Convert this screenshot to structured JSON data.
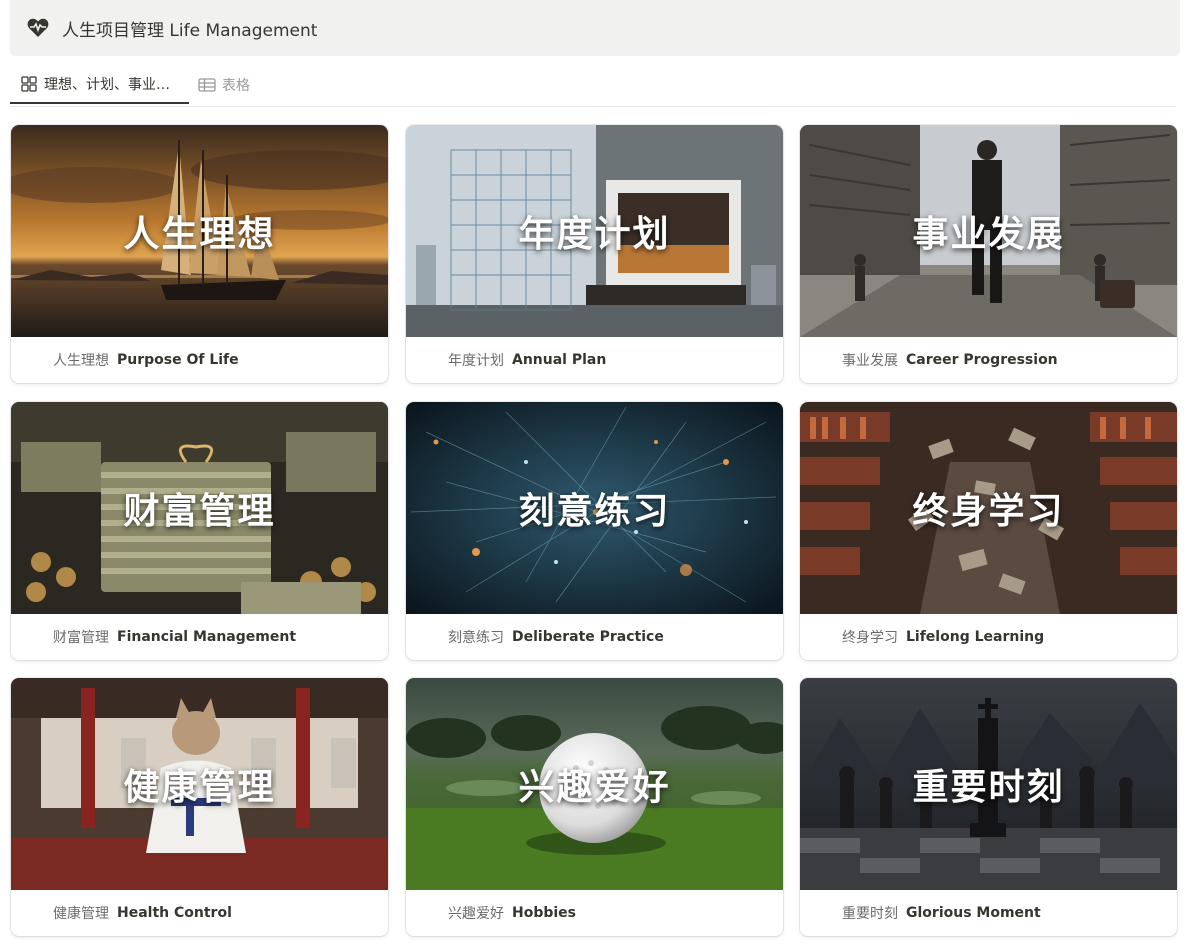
{
  "header": {
    "title": "人生项目管理  Life Management",
    "icon": "heart-pulse-icon"
  },
  "tabs": [
    {
      "label": "理想、计划、事业…",
      "icon": "gallery-icon",
      "active": true
    },
    {
      "label": "表格",
      "icon": "table-icon",
      "active": false
    }
  ],
  "cards": [
    {
      "cover_text": "人生理想",
      "cn": "人生理想",
      "en": "Purpose Of Life",
      "scene": "sailboat-sunset"
    },
    {
      "cover_text": "年度计划",
      "cn": "年度计划",
      "en": "Annual Plan",
      "scene": "architecture"
    },
    {
      "cover_text": "事业发展",
      "cn": "事业发展",
      "en": "Career Progression",
      "scene": "city-businessman"
    },
    {
      "cover_text": "财富管理",
      "cn": "财富管理",
      "en": "Financial Management",
      "scene": "money-stacks"
    },
    {
      "cover_text": "刻意练习",
      "cn": "刻意练习",
      "en": "Deliberate Practice",
      "scene": "neural-network"
    },
    {
      "cover_text": "终身学习",
      "cn": "终身学习",
      "en": "Lifelong Learning",
      "scene": "library-books"
    },
    {
      "cover_text": "健康管理",
      "cn": "健康管理",
      "en": "Health Control",
      "scene": "karate-cat"
    },
    {
      "cover_text": "兴趣爱好",
      "cn": "兴趣爱好",
      "en": "Hobbies",
      "scene": "golf-ball"
    },
    {
      "cover_text": "重要时刻",
      "cn": "重要时刻",
      "en": "Glorious Moment",
      "scene": "chess-king"
    }
  ]
}
